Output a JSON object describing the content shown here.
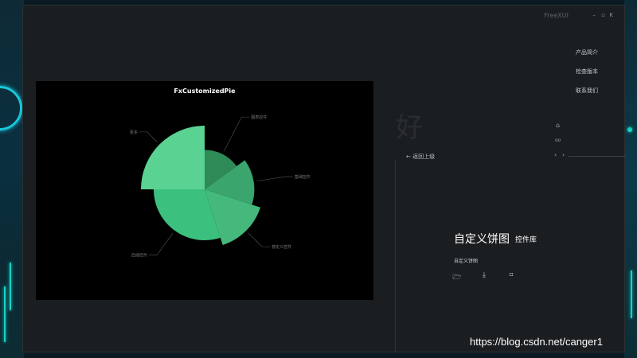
{
  "window": {
    "title": "FreeXUI"
  },
  "window_controls": {
    "minimize": "–",
    "restore": "▫",
    "close": "K"
  },
  "watermark_char": "好",
  "menu": [
    {
      "label": "产品简介"
    },
    {
      "label": "检查版本"
    },
    {
      "label": "联系我们"
    }
  ],
  "side_icons": {
    "home": "⌂",
    "link": "oo",
    "prev": "‹",
    "next": "›"
  },
  "back_link": {
    "arrow": "←",
    "label": "返回上级"
  },
  "info": {
    "title": "自定义饼图",
    "subtitle": "控件库",
    "description": "自定义饼图"
  },
  "toolbar": {
    "open": "🗁",
    "download": "⤓",
    "code": "⌗"
  },
  "url_watermark": "https://blog.csdn.net/canger1",
  "chart_data": {
    "type": "pie",
    "title": "FxCustomizedPie",
    "colors": [
      "#5ad392",
      "#2e8b57",
      "#3aa56c",
      "#45b97c",
      "#3cc07d"
    ],
    "slices": [
      {
        "label": "更多",
        "value": 25,
        "radius": 1.0
      },
      {
        "label": "图表控件",
        "value": 15,
        "radius": 0.62
      },
      {
        "label": "基础控件",
        "value": 15,
        "radius": 0.78
      },
      {
        "label": "按定义控件",
        "value": 15,
        "radius": 0.92
      },
      {
        "label": "后续控件",
        "value": 30,
        "radius": 0.8
      }
    ]
  }
}
